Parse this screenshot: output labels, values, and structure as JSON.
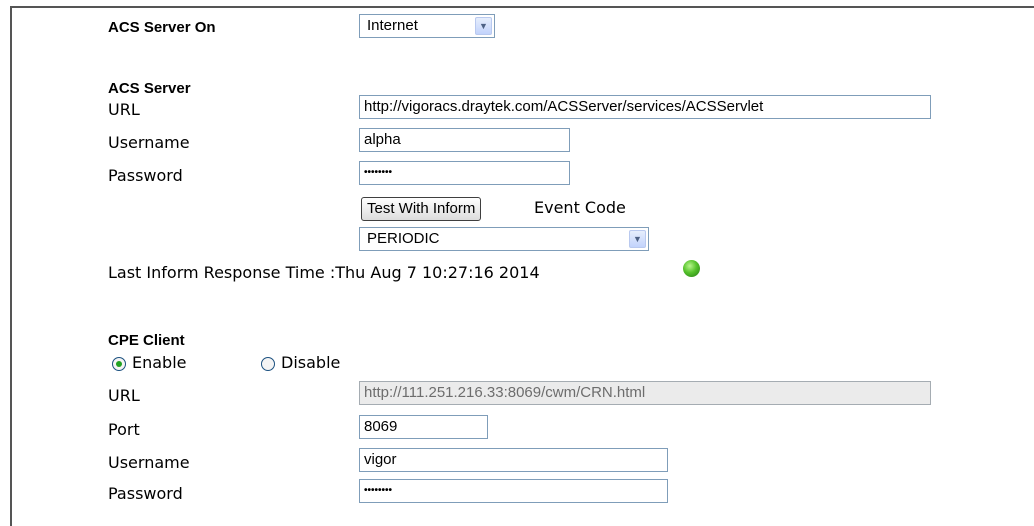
{
  "acs_server_on": {
    "label": "ACS Server On",
    "value": "Internet"
  },
  "acs_server": {
    "heading": "ACS Server",
    "url_label": "URL",
    "url_value": "http://vigoracs.draytek.com/ACSServer/services/ACSServlet",
    "username_label": "Username",
    "username_value": "alpha",
    "password_label": "Password",
    "password_value": "••••••••",
    "test_button": "Test With Inform",
    "event_code_label": "Event Code",
    "event_code_value": "PERIODIC",
    "last_inform": "Last Inform Response Time :Thu Aug 7 10:27:16 2014"
  },
  "cpe_client": {
    "heading": "CPE Client",
    "enable_label": "Enable",
    "disable_label": "Disable",
    "selected": "Enable",
    "url_label": "URL",
    "url_value": "http://111.251.216.33:8069/cwm/CRN.html",
    "port_label": "Port",
    "port_value": "8069",
    "username_label": "Username",
    "username_value": "vigor",
    "password_label": "Password",
    "password_value": "••••••••"
  },
  "colors": {
    "status_led": "#56c22c",
    "field_border": "#7f9db9",
    "disabled_bg": "#ebebeb"
  },
  "icons": {
    "status": "green-led-icon",
    "dropdown": "chevron-down-icon"
  }
}
